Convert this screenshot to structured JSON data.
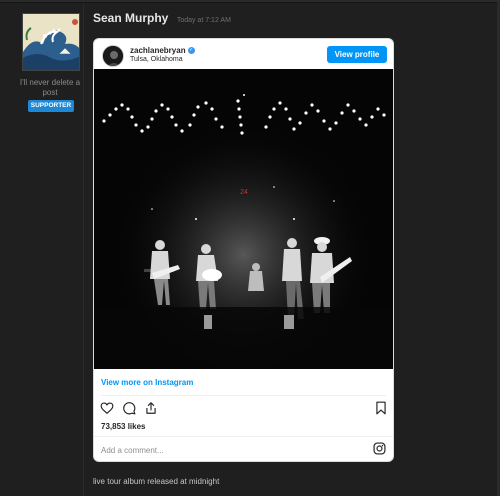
{
  "user": {
    "name": "Sean Murphy",
    "title_line1": "I'll never delete a",
    "title_line2": "post",
    "badge": "SUPPORTER",
    "avatar_icon": "wave-painting-avatar"
  },
  "post": {
    "timestamp": "Today at 7:12 AM",
    "caption": "live tour album released at midnight"
  },
  "instagram": {
    "username": "zachlanebryan",
    "location": "Tulsa, Oklahoma",
    "view_profile_label": "View profile",
    "view_more_label": "View more on Instagram",
    "likes": "73,853 likes",
    "comment_placeholder": "Add a comment...",
    "photo_overlay_text": "24",
    "icons": [
      "heart-icon",
      "comment-icon",
      "share-icon",
      "bookmark-icon",
      "instagram-logo-icon",
      "verified-badge-icon"
    ]
  },
  "colors": {
    "background": "#1f1f1f",
    "badge": "#1e88d6",
    "ig_blue": "#0095f6",
    "text_light": "#e6e6e6"
  }
}
